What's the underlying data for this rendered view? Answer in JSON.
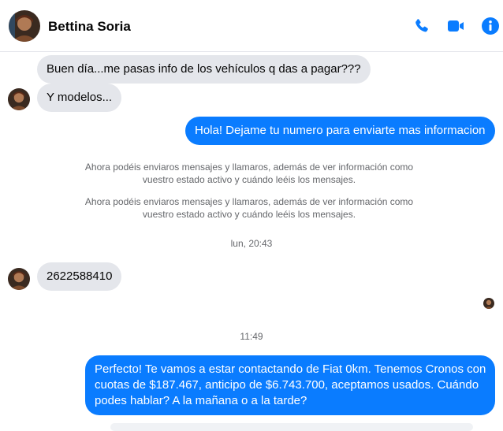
{
  "header": {
    "contact_name": "Bettina Soria",
    "icons": [
      "phone-icon",
      "video-camera-icon",
      "info-icon"
    ],
    "accent": "#0a7cff"
  },
  "messages": {
    "m1": "Buen día...me pasas info de los vehículos q das a pagar???",
    "m2": "Y modelos...",
    "m3": "Hola! Dejame tu numero para enviarte mas informacion",
    "sys1_line1": "Ahora podéis enviaros mensajes y llamaros, además de ver información como",
    "sys1_line2": "vuestro estado activo y cuándo leéis los mensajes.",
    "sys2_line1": "Ahora podéis enviaros mensajes y llamaros, además de ver información como",
    "sys2_line2": "vuestro estado activo y cuándo leéis los mensajes.",
    "time1": "lun, 20:43",
    "m4": "2622588410",
    "time2": "11:49",
    "m5_line1": "Perfecto! Te vamos a estar contactando de Fiat 0km. Tenemos Cronos con",
    "m5_line2": "cuotas de $187.467, anticipo de $6.743.700, aceptamos usados. Cuándo",
    "m5_line3": "podes hablar? A la mañana o a la tarde?"
  },
  "colors": {
    "incoming_bubble": "#e4e6eb",
    "outgoing_bubble": "#0a7cff",
    "meta_text": "#65676b"
  }
}
